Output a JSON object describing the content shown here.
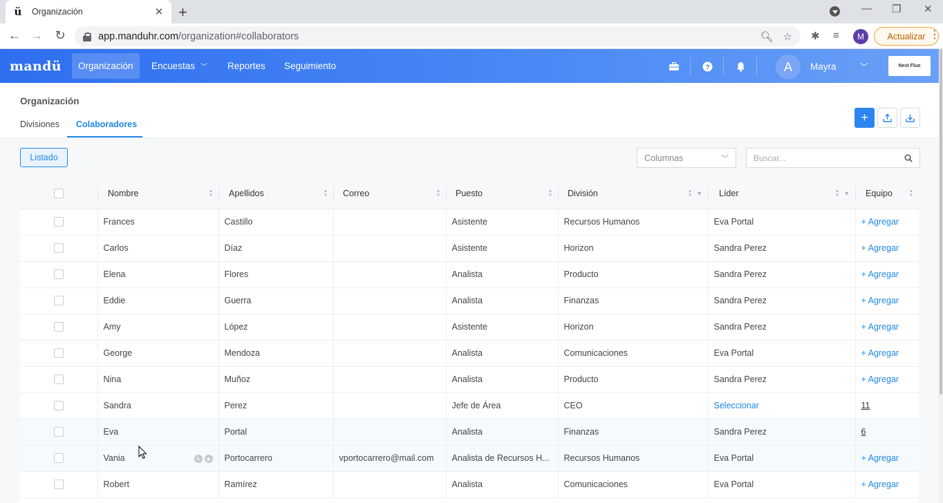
{
  "browser": {
    "tab_title": "Organización",
    "favicon": "ü",
    "url_host": "app.manduhr.com",
    "url_path": "/organization#collaborators",
    "avatar_letter": "M",
    "update_label": "Actualizar"
  },
  "app": {
    "logo": "mandü",
    "nav": [
      "Organización",
      "Encuestas",
      "Reportes",
      "Seguimiento"
    ],
    "user": {
      "initial": "A",
      "name": "Mayra"
    },
    "brand": "Nest Fluo"
  },
  "page": {
    "title": "Organización",
    "tabs": [
      "Divisiones",
      "Colaboradores"
    ]
  },
  "toolbar": {
    "listado_label": "Listado",
    "columns_placeholder": "Columnas",
    "search_placeholder": "Buscar..."
  },
  "table": {
    "headers": [
      "Nombre",
      "Apellidos",
      "Correo",
      "Puesto",
      "División",
      "Líder",
      "Equipo"
    ],
    "rows": [
      {
        "nombre": "Frances",
        "apellidos": "Castillo",
        "correo": "",
        "puesto": "Asistente",
        "division": "Recursos Humanos",
        "lider": "Eva Portal",
        "equipo": "+ Agregar"
      },
      {
        "nombre": "Carlos",
        "apellidos": "Díaz",
        "correo": "",
        "puesto": "Asistente",
        "division": "Horizon",
        "lider": "Sandra Perez",
        "equipo": "+ Agregar"
      },
      {
        "nombre": "Elena",
        "apellidos": "Flores",
        "correo": "",
        "puesto": "Analista",
        "division": "Producto",
        "lider": "Sandra Perez",
        "equipo": "+ Agregar"
      },
      {
        "nombre": "Eddie",
        "apellidos": "Guerra",
        "correo": "",
        "puesto": "Analista",
        "division": "Finanzas",
        "lider": "Sandra Perez",
        "equipo": "+ Agregar"
      },
      {
        "nombre": "Amy",
        "apellidos": "López",
        "correo": "",
        "puesto": "Asistente",
        "division": "Horizon",
        "lider": "Sandra Perez",
        "equipo": "+ Agregar"
      },
      {
        "nombre": "George",
        "apellidos": "Mendoza",
        "correo": "",
        "puesto": "Analista",
        "division": "Comunicaciones",
        "lider": "Eva Portal",
        "equipo": "+ Agregar"
      },
      {
        "nombre": "Nina",
        "apellidos": "Muñoz",
        "correo": "",
        "puesto": "Analista",
        "division": "Producto",
        "lider": "Sandra Perez",
        "equipo": "+ Agregar"
      },
      {
        "nombre": "Sandra",
        "apellidos": "Perez",
        "correo": "",
        "puesto": "Jefe de Área",
        "division": "CEO",
        "lider": "Seleccionar",
        "equipo": "11"
      },
      {
        "nombre": "Eva",
        "apellidos": "Portal",
        "correo": "",
        "puesto": "Analista",
        "division": "Finanzas",
        "lider": "Sandra Perez",
        "equipo": "6"
      },
      {
        "nombre": "Vania",
        "apellidos": "Portocarrero",
        "correo": "vportocarrero@mail.com",
        "puesto": "Analista de Recursos H...",
        "division": "Recursos Humanos",
        "lider": "Eva Portal",
        "equipo": "+ Agregar"
      },
      {
        "nombre": "Robert",
        "apellidos": "Ramírez",
        "correo": "",
        "puesto": "Analista",
        "division": "Comunicaciones",
        "lider": "Eva Portal",
        "equipo": "+ Agregar"
      }
    ]
  }
}
